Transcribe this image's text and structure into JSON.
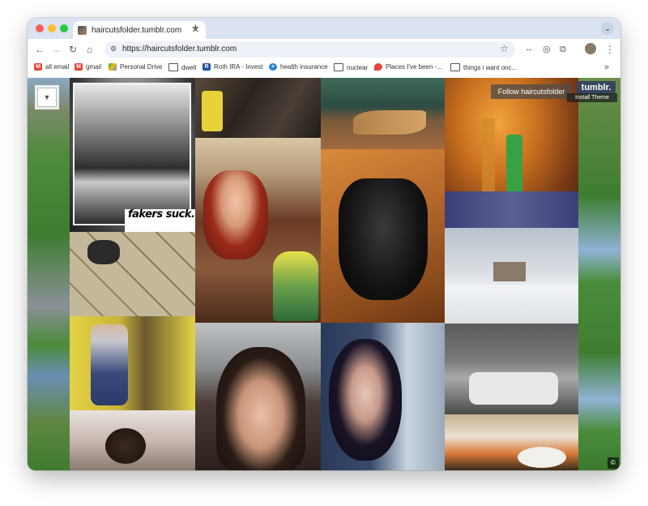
{
  "browser": {
    "tab_title": "haircutsfolder.tumblr.com",
    "url": "https://haircutsfolder.tumblr.com"
  },
  "bookmarks": [
    {
      "label": "all email",
      "icon": "gmail-icon"
    },
    {
      "label": "gmail",
      "icon": "gmail-icon"
    },
    {
      "label": "Personal Drive",
      "icon": "drive-icon"
    },
    {
      "label": "dwell",
      "icon": "folder-icon"
    },
    {
      "label": "Roth IRA - Invest",
      "icon": "rk-icon"
    },
    {
      "label": "health insurance",
      "icon": "health-icon"
    },
    {
      "label": "nuclear",
      "icon": "folder-icon"
    },
    {
      "label": "Places I've been -...",
      "icon": "maps-icon"
    },
    {
      "label": "things i want onc...",
      "icon": "folder-icon"
    }
  ],
  "page": {
    "follow_label": "Follow haircutsfolder",
    "tumblr_logo": "tumblr.",
    "install_theme": "Install Theme",
    "photo_caption": "fakers suck.",
    "copyright_symbol": "©"
  },
  "colors": {
    "chrome_bg": "#dbe3f1",
    "tumblr_brand": "#36465d"
  }
}
